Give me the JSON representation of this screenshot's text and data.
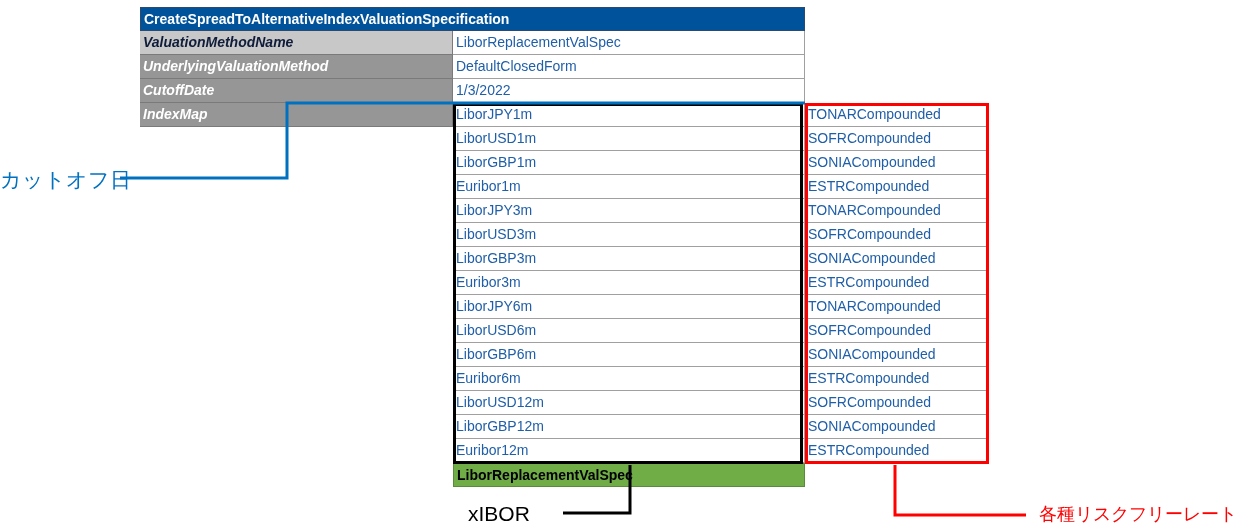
{
  "table": {
    "title": "CreateSpreadToAlternativeIndexValuationSpecification",
    "fields": [
      {
        "kind": "key",
        "label": "ValuationMethodName",
        "value": "LiborReplacementValSpec"
      },
      {
        "kind": "field",
        "label": "UnderlyingValuationMethod",
        "value": "DefaultClosedForm"
      },
      {
        "kind": "field",
        "label": "CutoffDate",
        "value": "1/3/2022"
      }
    ],
    "index_map": {
      "label": "IndexMap",
      "rows": [
        {
          "from": "LiborJPY1m",
          "to": "TONARCompounded"
        },
        {
          "from": "LiborUSD1m",
          "to": "SOFRCompounded"
        },
        {
          "from": "LiborGBP1m",
          "to": "SONIACompounded"
        },
        {
          "from": "Euribor1m",
          "to": "ESTRCompounded"
        },
        {
          "from": "LiborJPY3m",
          "to": "TONARCompounded"
        },
        {
          "from": "LiborUSD3m",
          "to": "SOFRCompounded"
        },
        {
          "from": "LiborGBP3m",
          "to": "SONIACompounded"
        },
        {
          "from": "Euribor3m",
          "to": "ESTRCompounded"
        },
        {
          "from": "LiborJPY6m",
          "to": "TONARCompounded"
        },
        {
          "from": "LiborUSD6m",
          "to": "SOFRCompounded"
        },
        {
          "from": "LiborGBP6m",
          "to": "SONIACompounded"
        },
        {
          "from": "Euribor6m",
          "to": "ESTRCompounded"
        },
        {
          "from": "LiborUSD12m",
          "to": "SOFRCompounded"
        },
        {
          "from": "LiborGBP12m",
          "to": "SONIACompounded"
        },
        {
          "from": "Euribor12m",
          "to": "ESTRCompounded"
        }
      ]
    },
    "footer": "LiborReplacementValSpec"
  },
  "annotations": [
    {
      "text": "カットオフ日",
      "color": "#0070c0"
    },
    {
      "text": "xIBOR",
      "color": "#000000"
    },
    {
      "text": "各種リスクフリーレート",
      "color": "#ff0000"
    }
  ]
}
